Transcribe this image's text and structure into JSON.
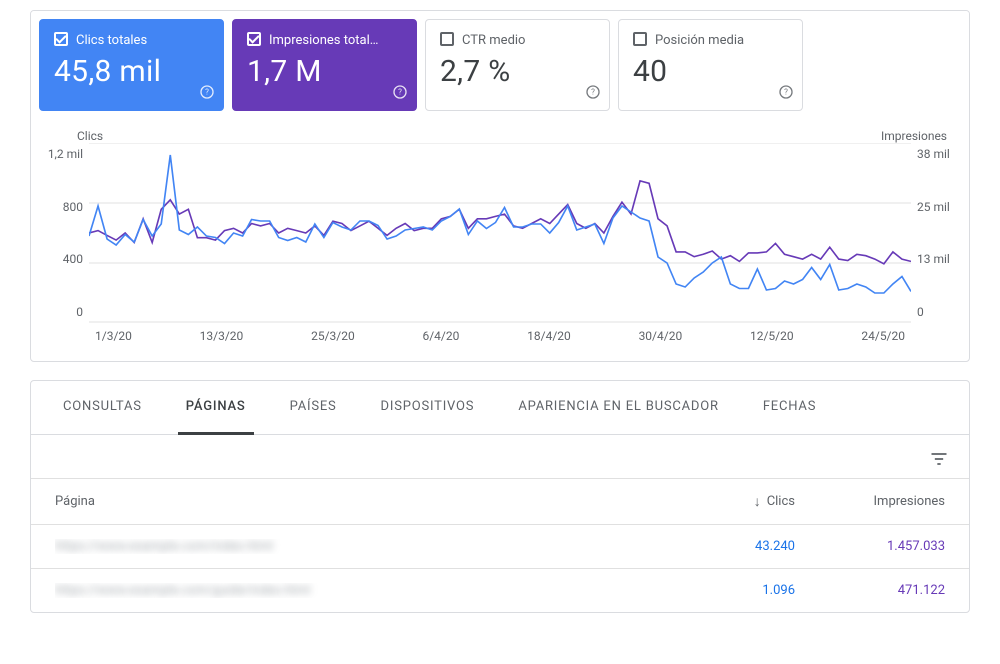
{
  "cards": [
    {
      "label": "Clics totales",
      "value": "45,8 mil",
      "checked": true,
      "variant": "blue"
    },
    {
      "label": "Impresiones total…",
      "value": "1,7 M",
      "checked": true,
      "variant": "purple"
    },
    {
      "label": "CTR medio",
      "value": "2,7 %",
      "checked": false,
      "variant": "muted"
    },
    {
      "label": "Posición media",
      "value": "40",
      "checked": false,
      "variant": "muted"
    }
  ],
  "chart": {
    "left_title": "Clics",
    "right_title": "Impresiones",
    "y_left": [
      "1,2 mil",
      "800",
      "400",
      "0"
    ],
    "y_right": [
      "38 mil",
      "25 mil",
      "13 mil",
      "0"
    ],
    "x": [
      "1/3/20",
      "13/3/20",
      "25/3/20",
      "6/4/20",
      "18/4/20",
      "30/4/20",
      "12/5/20",
      "24/5/20"
    ]
  },
  "chart_data": {
    "type": "line",
    "xlabel": "",
    "left": {
      "label": "Clics",
      "ylim": [
        0,
        1200
      ],
      "ticks": [
        0,
        400,
        800,
        1200
      ]
    },
    "right": {
      "label": "Impresiones",
      "ylim": [
        0,
        38000
      ],
      "ticks": [
        0,
        13000,
        25000,
        38000
      ]
    },
    "x_ticks": [
      "1/3/20",
      "13/3/20",
      "25/3/20",
      "6/4/20",
      "18/4/20",
      "30/4/20",
      "12/5/20",
      "24/5/20"
    ],
    "n_points": 92,
    "series": [
      {
        "name": "Clics",
        "axis": "left",
        "color": "#4285f4",
        "values": [
          580,
          780,
          560,
          520,
          590,
          540,
          690,
          580,
          660,
          1120,
          620,
          590,
          640,
          580,
          570,
          530,
          600,
          580,
          690,
          680,
          680,
          570,
          550,
          570,
          540,
          660,
          570,
          670,
          640,
          620,
          680,
          680,
          650,
          560,
          580,
          620,
          630,
          640,
          620,
          680,
          710,
          760,
          590,
          680,
          630,
          670,
          770,
          640,
          640,
          660,
          660,
          600,
          670,
          780,
          620,
          640,
          660,
          530,
          700,
          780,
          740,
          700,
          680,
          440,
          400,
          260,
          240,
          300,
          340,
          400,
          440,
          260,
          230,
          230,
          360,
          220,
          230,
          280,
          260,
          290,
          370,
          290,
          390,
          220,
          230,
          260,
          240,
          200,
          200,
          260,
          310,
          210
        ]
      },
      {
        "name": "Impresiones",
        "axis": "right",
        "color": "#673ab7",
        "values": [
          19000,
          19500,
          18500,
          17500,
          19000,
          17000,
          22000,
          17000,
          24000,
          26000,
          23000,
          24000,
          18000,
          18000,
          17500,
          19500,
          20000,
          19000,
          21000,
          20500,
          21000,
          19000,
          20000,
          19500,
          19000,
          20500,
          18500,
          21500,
          21000,
          19500,
          20500,
          21500,
          20000,
          18500,
          20000,
          21000,
          19500,
          20000,
          20000,
          22000,
          22500,
          24000,
          20000,
          22000,
          22000,
          22500,
          23000,
          20500,
          20000,
          21000,
          22000,
          21000,
          23000,
          25000,
          21000,
          20000,
          21000,
          19000,
          22500,
          25500,
          23000,
          30000,
          29500,
          22000,
          20500,
          15000,
          15000,
          14000,
          14500,
          15200,
          13500,
          14200,
          13000,
          14800,
          14800,
          15000,
          16800,
          14500,
          14000,
          13500,
          14500,
          13500,
          16000,
          13500,
          13200,
          14500,
          14200,
          13500,
          12500,
          15000,
          13500,
          13000
        ]
      }
    ]
  },
  "tabs": [
    "CONSULTAS",
    "PÁGINAS",
    "PAÍSES",
    "DISPOSITIVOS",
    "APARIENCIA EN EL BUSCADOR",
    "FECHAS"
  ],
  "active_tab": 1,
  "table": {
    "headers": {
      "page": "Página",
      "clics": "Clics",
      "impr": "Impresiones"
    },
    "rows": [
      {
        "page": "https://www.example.com/index.html",
        "clics": "43.240",
        "impr": "1.457.033"
      },
      {
        "page": "https://www.example.com/guide/index.html",
        "clics": "1.096",
        "impr": "471.122"
      }
    ]
  },
  "icons": {
    "help": "?",
    "filter": "filter-icon",
    "sort": "↓"
  }
}
